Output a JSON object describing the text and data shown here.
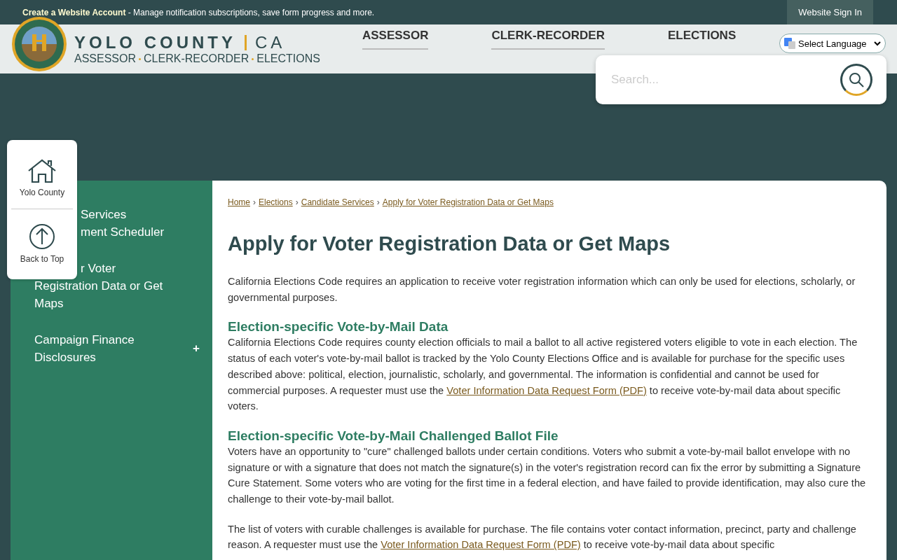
{
  "top_bar": {
    "account_link": "Create a Website Account",
    "account_note": " - Manage notification subscriptions, save form progress and more.",
    "sign_in": "Website Sign In"
  },
  "header": {
    "title": "YOLO COUNTY",
    "title_suffix": "CA",
    "subtitle": [
      "ASSESSOR",
      "CLERK-RECORDER",
      "ELECTIONS"
    ],
    "nav": [
      {
        "label": "ASSESSOR",
        "underline": true
      },
      {
        "label": "CLERK-RECORDER",
        "underline": true
      },
      {
        "label": "ELECTIONS",
        "underline": false
      }
    ],
    "language": "Select Language",
    "search": {
      "placeholder": "Search..."
    }
  },
  "quick_links": [
    {
      "kind": "home",
      "label": "Yolo County"
    },
    {
      "kind": "top",
      "label": "Back to Top"
    }
  ],
  "sidebar": {
    "items": [
      {
        "lines": [
          {
            "text": "Services",
            "covered": true
          },
          {
            "text": "ment Scheduler",
            "covered": true
          }
        ]
      },
      {
        "lines": [
          {
            "text": "r Voter",
            "covered": true
          },
          {
            "text": "Registration Data or Get"
          },
          {
            "text": "Maps"
          }
        ]
      },
      {
        "lines": [
          {
            "text": "Campaign Finance"
          },
          {
            "text": "Disclosures"
          }
        ],
        "expandable": true,
        "expand_sign": "+"
      }
    ]
  },
  "breadcrumb": [
    "Home",
    "Elections",
    "Candidate Services",
    "Apply for Voter Registration Data or Get Maps"
  ],
  "breadcrumb_sep": "›",
  "title": "Apply for Voter Registration Data or Get Maps",
  "intro": "California Elections Code requires an application to receive voter registration information which can only be used for elections, scholarly, or governmental purposes.",
  "sections": [
    {
      "heading": "Election-specific Vote-by-Mail Data",
      "paragraphs": [
        {
          "before": "California Elections Code requires county election officials to mail a ballot to all active registered voters eligible to vote in each election. The status of each voter's vote-by-mail ballot is tracked by the Yolo County Elections Office and is available for purchase for the specific uses described above: political, election, journalistic, scholarly, and governmental. The information is confidential and cannot be used for commercial purposes. A requester must use the ",
          "link": "Voter Information Data Request Form (PDF)",
          "after": " to receive vote-by-mail data about specific voters."
        }
      ]
    },
    {
      "heading": "Election-specific Vote-by-Mail Challenged Ballot File",
      "paragraphs": [
        {
          "before": "Voters have an opportunity to \"cure\" challenged ballots under certain conditions. Voters who submit a vote-by-mail ballot envelope with no signature or with a signature that does not match the signature(s) in the voter's registration record can fix the error by submitting a Signature Cure Statement. Some voters who are voting for the first time in a federal election, and have failed to provide identification, may also cure the challenge to their vote-by-mail ballot."
        },
        {
          "before": "The list of voters with curable challenges is available for purchase. The file contains voter contact information, precinct, party and challenge reason. A requester must use the ",
          "link": "Voter Information Data Request Form (PDF)",
          "after": " to receive vote-by-mail data about specific"
        }
      ]
    }
  ]
}
